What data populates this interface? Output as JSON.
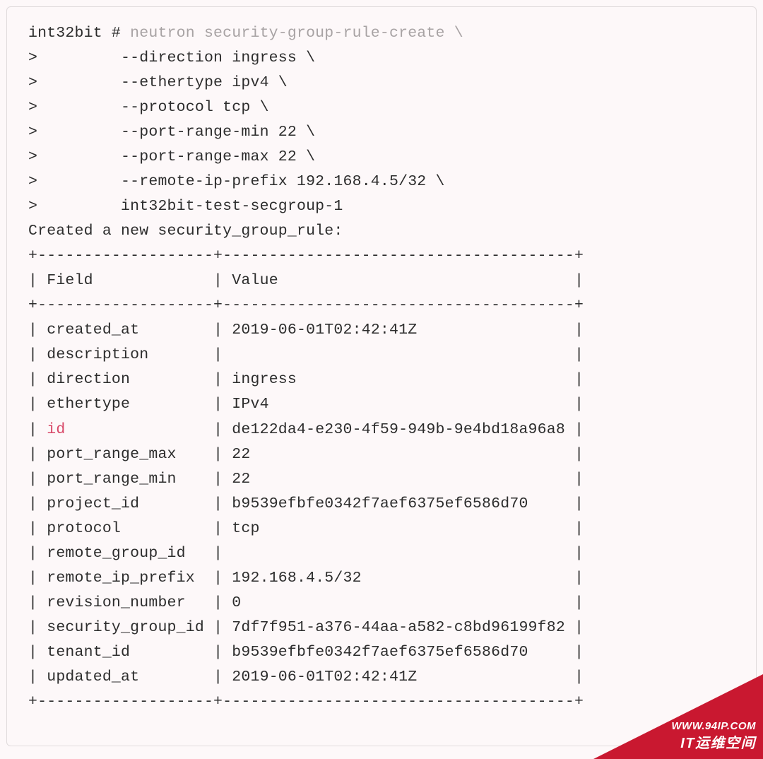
{
  "terminal": {
    "prompt": "int32bit",
    "prompt_separator": " # ",
    "command_lines": [
      "neutron security-group-rule-create \\",
      "    --direction ingress \\",
      "    --ethertype ipv4 \\",
      "    --protocol tcp \\",
      "    --port-range-min 22 \\",
      "    --port-range-max 22 \\",
      "    --remote-ip-prefix 192.168.4.5/32 \\",
      "    int32bit-test-secgroup-1"
    ],
    "continuation_prompt": ">",
    "output_header": "Created a new security_group_rule:",
    "table": {
      "border_top": "+-------------------+--------------------------------------+",
      "header_field": "Field",
      "header_value": "Value",
      "rows": [
        {
          "field": "created_at",
          "value": "2019-06-01T02:42:41Z",
          "highlight": false
        },
        {
          "field": "description",
          "value": "",
          "highlight": false
        },
        {
          "field": "direction",
          "value": "ingress",
          "highlight": false
        },
        {
          "field": "ethertype",
          "value": "IPv4",
          "highlight": false
        },
        {
          "field": "id",
          "value": "de122da4-e230-4f59-949b-9e4bd18a96a8",
          "highlight": true
        },
        {
          "field": "port_range_max",
          "value": "22",
          "highlight": false
        },
        {
          "field": "port_range_min",
          "value": "22",
          "highlight": false
        },
        {
          "field": "project_id",
          "value": "b9539efbfe0342f7aef6375ef6586d70",
          "highlight": false
        },
        {
          "field": "protocol",
          "value": "tcp",
          "highlight": false
        },
        {
          "field": "remote_group_id",
          "value": "",
          "highlight": false
        },
        {
          "field": "remote_ip_prefix",
          "value": "192.168.4.5/32",
          "highlight": false
        },
        {
          "field": "revision_number",
          "value": "0",
          "highlight": false
        },
        {
          "field": "security_group_id",
          "value": "7df7f951-a376-44aa-a582-c8bd96199f82",
          "highlight": false
        },
        {
          "field": "tenant_id",
          "value": "b9539efbfe0342f7aef6375ef6586d70",
          "highlight": false
        },
        {
          "field": "updated_at",
          "value": "2019-06-01T02:42:41Z",
          "highlight": false
        }
      ]
    }
  },
  "watermark": {
    "url": "WWW.94IP.COM",
    "label": "IT运维空间"
  }
}
